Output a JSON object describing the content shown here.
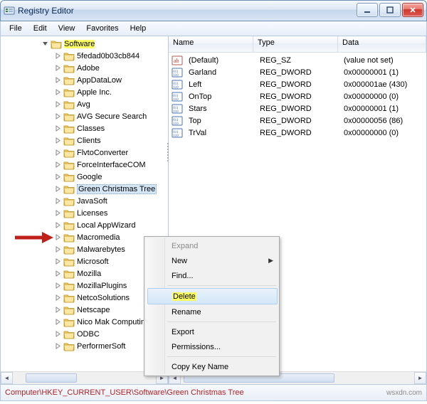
{
  "window": {
    "title": "Registry Editor"
  },
  "menu": {
    "file": "File",
    "edit": "Edit",
    "view": "View",
    "favorites": "Favorites",
    "help": "Help"
  },
  "tree": {
    "root": "Software",
    "items": [
      "5fedad0b03cb844",
      "Adobe",
      "AppDataLow",
      "Apple Inc.",
      "Avg",
      "AVG Secure Search",
      "Classes",
      "Clients",
      "FlvtoConverter",
      "ForceInterfaceCOM",
      "Google",
      "Green Christmas Tree",
      "JavaSoft",
      "Licenses",
      "Local AppWizard",
      "Macromedia",
      "Malwarebytes",
      "Microsoft",
      "Mozilla",
      "MozillaPlugins",
      "NetcoSolutions",
      "Netscape",
      "Nico Mak Computing",
      "ODBC",
      "PerformerSoft"
    ],
    "selected_index": 11
  },
  "values": {
    "headers": {
      "name": "Name",
      "type": "Type",
      "data": "Data"
    },
    "rows": [
      {
        "name": "(Default)",
        "type": "REG_SZ",
        "data": "(value not set)",
        "kind": "sz"
      },
      {
        "name": "Garland",
        "type": "REG_DWORD",
        "data": "0x00000001 (1)",
        "kind": "dw"
      },
      {
        "name": "Left",
        "type": "REG_DWORD",
        "data": "0x000001ae (430)",
        "kind": "dw"
      },
      {
        "name": "OnTop",
        "type": "REG_DWORD",
        "data": "0x00000000 (0)",
        "kind": "dw"
      },
      {
        "name": "Stars",
        "type": "REG_DWORD",
        "data": "0x00000001 (1)",
        "kind": "dw"
      },
      {
        "name": "Top",
        "type": "REG_DWORD",
        "data": "0x00000056 (86)",
        "kind": "dw"
      },
      {
        "name": "TrVal",
        "type": "REG_DWORD",
        "data": "0x00000000 (0)",
        "kind": "dw"
      }
    ]
  },
  "context_menu": {
    "expand": "Expand",
    "new": "New",
    "find": "Find...",
    "delete": "Delete",
    "rename": "Rename",
    "export": "Export",
    "permissions": "Permissions...",
    "copy_key_name": "Copy Key Name"
  },
  "status": {
    "path": "Computer\\HKEY_CURRENT_USER\\Software\\Green Christmas Tree"
  },
  "watermark": "wsxdn.com"
}
